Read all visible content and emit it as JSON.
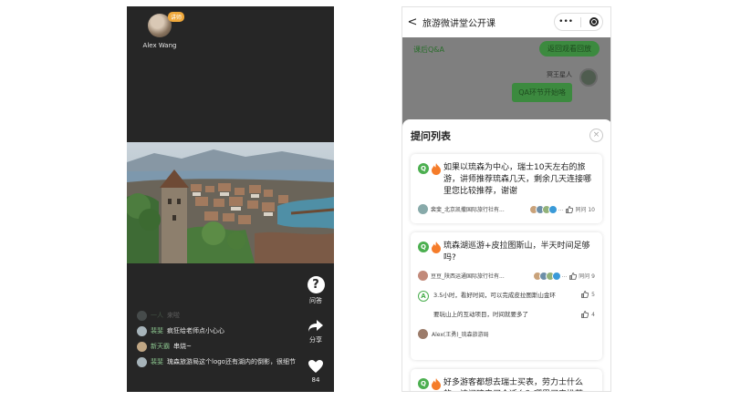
{
  "live": {
    "host_name": "Alex Wang",
    "host_tag": "讲师",
    "buttons": {
      "question": "问答",
      "share": "分享",
      "like_count": "84"
    },
    "comments": [
      {
        "user": "一人",
        "text": "来啦",
        "faint": true
      },
      {
        "user": "裴斐",
        "text": "疯狂给老师点小心心"
      },
      {
        "user": "新天霸",
        "text": "串烧~"
      },
      {
        "user": "裴斐",
        "text": "琉森旅游局这个logo还有湖内的倒影，很细节"
      }
    ]
  },
  "mini": {
    "nav_title": "旅游微讲堂公开课",
    "back": "<",
    "capsule_more": "•••",
    "qa_header": "课后Q&A",
    "replay_button": "返回观看回放",
    "chat": {
      "user": "冥王星人",
      "text": "QA环节开始咯"
    },
    "panel_title": "提问列表",
    "close": "×",
    "questions": [
      {
        "badge": "Q",
        "text": "如果以琉森为中心，瑞士10天左右的旅游，讲师推荐琉森几天，剩余几天连接哪里您比较推荐，谢谢",
        "asker": "裴斐_北京凯撒国际旅行社有...",
        "same_label": "同问 10"
      },
      {
        "badge": "Q",
        "text": "琉森湖巡游+皮拉图斯山，半天时间足够吗?",
        "asker": "豆豆_陕西运通国际旅行社有...",
        "same_label": "同问 9",
        "answers": [
          {
            "badge": "A",
            "text": "3.5小时，看好时间，可以完成皮拉图斯山金环",
            "likes": "5"
          },
          {
            "text": "要玩山上的互动项目，时间就要多了",
            "likes": "4"
          }
        ],
        "answerer": "Alex(王勇)_琉森旅游局"
      },
      {
        "badge": "Q",
        "text": "好多游客都想去瑞士买表，劳力士什么的，请问琉森买合适么？哪里买表推荐"
      }
    ]
  },
  "colors": {
    "green": "#4caf50",
    "dark": "#262626"
  }
}
